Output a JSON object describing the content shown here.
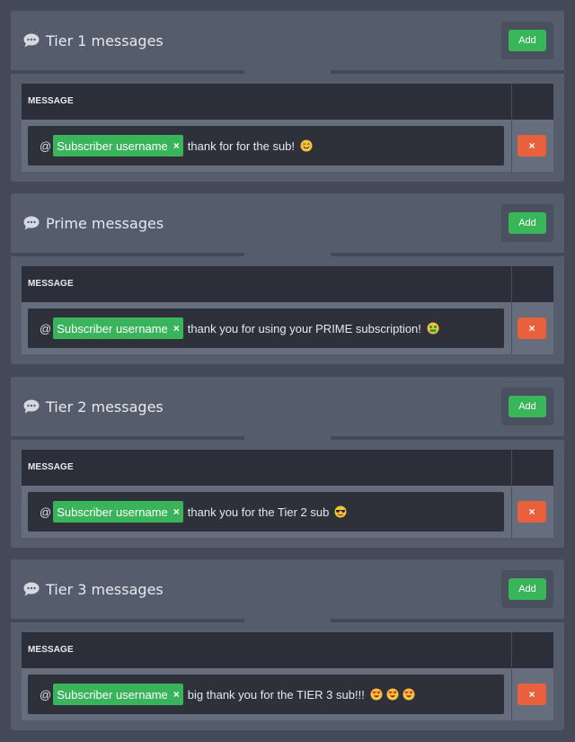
{
  "colors": {
    "page_bg": "#434957",
    "panel_bg": "#555c6b",
    "table_header_bg": "#2c2f39",
    "input_bg": "#2e313a",
    "add_green": "#3ab65a",
    "chip_green": "#39b45a",
    "delete_orange": "#e8603c"
  },
  "sections": [
    {
      "title": "Tier 1 messages",
      "icon": "speech-bubble-icon",
      "add_label": "Add",
      "column_header": "MESSAGE",
      "row": {
        "prefix": "@",
        "chip_label": "Subscriber username",
        "chip_remove": "×",
        "text": "thank for for the sub!",
        "emojis": [
          "smiling-face-icon"
        ],
        "delete_label": "×"
      }
    },
    {
      "title": "Prime messages",
      "icon": "speech-bubble-icon",
      "add_label": "Add",
      "column_header": "MESSAGE",
      "row": {
        "prefix": "@",
        "chip_label": "Subscriber username",
        "chip_remove": "×",
        "text": "thank you for using your PRIME subscription!",
        "emojis": [
          "money-mouth-face-icon"
        ],
        "delete_label": "×"
      }
    },
    {
      "title": "Tier 2 messages",
      "icon": "speech-bubble-icon",
      "add_label": "Add",
      "column_header": "MESSAGE",
      "row": {
        "prefix": "@",
        "chip_label": "Subscriber username",
        "chip_remove": "×",
        "text": "thank you for the Tier 2 sub",
        "emojis": [
          "sunglasses-face-icon"
        ],
        "delete_label": "×"
      }
    },
    {
      "title": "Tier 3 messages",
      "icon": "speech-bubble-icon",
      "add_label": "Add",
      "column_header": "MESSAGE",
      "row": {
        "prefix": "@",
        "chip_label": "Subscriber username",
        "chip_remove": "×",
        "text": "big thank you for the TIER 3 sub!!!",
        "emojis": [
          "heart-eyes-face-icon",
          "heart-eyes-face-icon",
          "heart-eyes-face-icon"
        ],
        "delete_label": "×"
      }
    }
  ]
}
